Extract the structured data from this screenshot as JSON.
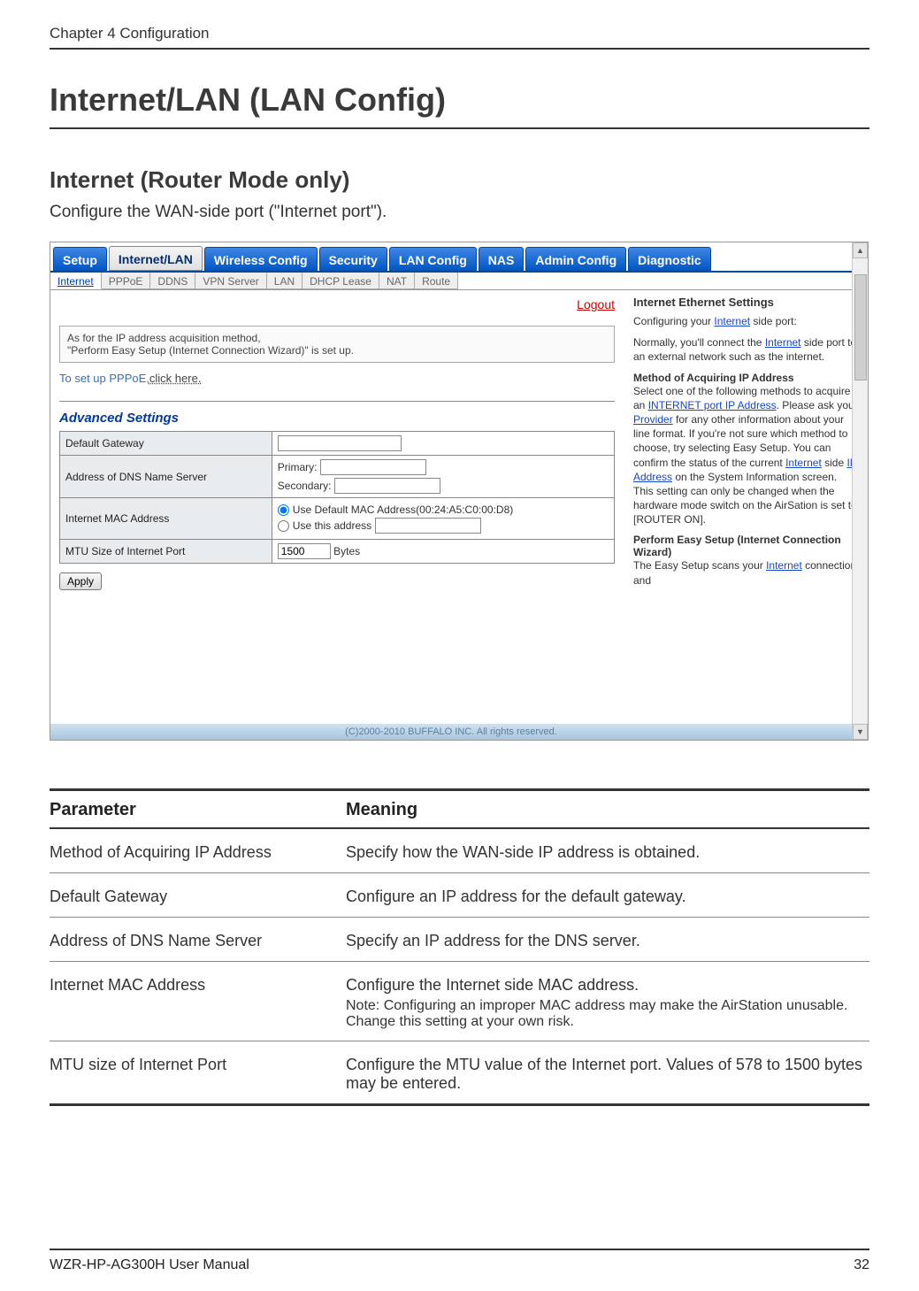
{
  "chapter_header": "Chapter 4  Configuration",
  "h1": "Internet/LAN (LAN Config)",
  "h2": "Internet (Router Mode only)",
  "lead": "Configure the WAN-side port (\"Internet port\").",
  "screenshot": {
    "main_tabs": [
      "Setup",
      "Internet/LAN",
      "Wireless Config",
      "Security",
      "LAN Config",
      "NAS",
      "Admin Config",
      "Diagnostic"
    ],
    "main_tab_active_index": 1,
    "sub_tabs": [
      "Internet",
      "PPPoE",
      "DDNS",
      "VPN Server",
      "LAN",
      "DHCP Lease",
      "NAT",
      "Route"
    ],
    "sub_tab_active_index": 0,
    "logout": "Logout",
    "basic_box_line1": "As for the IP address acquisition method,",
    "basic_box_line2": "\"Perform Easy Setup (Internet Connection Wizard)\" is set up.",
    "pppoe_prefix": "To set up PPPoE,",
    "pppoe_link": "click here.",
    "advanced_title": "Advanced Settings",
    "rows": {
      "default_gateway": {
        "label": "Default Gateway",
        "value": ""
      },
      "dns": {
        "label": "Address of DNS Name Server",
        "primary_label": "Primary:",
        "primary_value": "",
        "secondary_label": "Secondary:",
        "secondary_value": ""
      },
      "mac": {
        "label": "Internet MAC Address",
        "opt_default": "Use Default MAC Address(00:24:A5:C0:00:D8)",
        "opt_custom": "Use this address",
        "custom_value": ""
      },
      "mtu": {
        "label": "MTU Size of Internet Port",
        "value": "1500",
        "unit": "Bytes"
      }
    },
    "apply": "Apply",
    "right": {
      "title": "Internet Ethernet Settings",
      "p1a": "Configuring your ",
      "p1_link1": "Internet",
      "p1b": " side port:",
      "p2a": "Normally, you'll connect the ",
      "p2_link1": "Internet",
      "p2b": " side port to an external network such as the internet.",
      "h2": "Method of Acquiring IP Address",
      "p3a": "Select one of the following methods to acquire an ",
      "p3_link1": "INTERNET port",
      "p3_link2": " IP Address",
      "p3b": ". Please ask your ",
      "p3_link3": "Provider",
      "p3c": " for any other information about your line format. If you're not sure which method to choose, try selecting Easy Setup. You can confirm the status of the current ",
      "p3_link4": "Internet",
      "p3d": " side ",
      "p3_link5": "IP Address",
      "p3e": " on the System Information screen. This setting can only be changed when the hardware mode switch on the AirSation is set to [ROUTER ON].",
      "h3": "Perform Easy Setup (Internet Connection Wizard)",
      "p4a": "The Easy Setup scans your ",
      "p4_link1": "Internet",
      "p4b": " connection and"
    },
    "copyright": "(C)2000-2010 BUFFALO INC. All rights reserved."
  },
  "param_table": {
    "head_param": "Parameter",
    "head_meaning": "Meaning",
    "rows": [
      {
        "param": "Method of Acquiring IP Address",
        "meaning": "Specify how the WAN-side IP address is obtained."
      },
      {
        "param": "Default Gateway",
        "meaning": "Configure an IP address for the default gateway."
      },
      {
        "param": "Address of DNS Name Server",
        "meaning": "Specify an IP address for the DNS server."
      },
      {
        "param": "Internet MAC Address",
        "meaning": "Configure the Internet side MAC address.",
        "note_label": "Note:",
        "note_text": " Configuring an improper MAC address may make the AirStation unusable. Change this setting at your own risk."
      },
      {
        "param": "MTU size of Internet Port",
        "meaning": "Configure the MTU value of the Internet port.  Values of 578 to 1500 bytes may be entered."
      }
    ]
  },
  "footer_left": "WZR-HP-AG300H User Manual",
  "footer_right": "32"
}
